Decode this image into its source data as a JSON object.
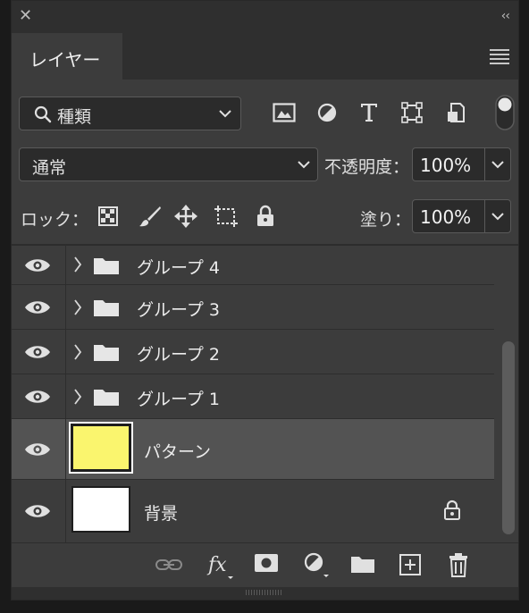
{
  "panel": {
    "tab_label": "レイヤー"
  },
  "filter": {
    "kind_label": "種類"
  },
  "blend": {
    "mode_label": "通常",
    "opacity_label": "不透明度：",
    "opacity_value": "100%"
  },
  "lock": {
    "label": "ロック：",
    "fill_label": "塗り：",
    "fill_value": "100%"
  },
  "layers": [
    {
      "name": "グループ 4",
      "type": "group"
    },
    {
      "name": "グループ 3",
      "type": "group"
    },
    {
      "name": "グループ 2",
      "type": "group"
    },
    {
      "name": "グループ 1",
      "type": "group"
    },
    {
      "name": "パターン",
      "type": "fill",
      "thumb_color": "#faf56e",
      "selected": true
    },
    {
      "name": "背景",
      "type": "background",
      "thumb_color": "#ffffff",
      "locked": true
    }
  ],
  "colors": {
    "panel_bg": "#3c3c3c",
    "selected_row": "#535353",
    "field_bg": "#2b2b2b"
  },
  "footer_icons": [
    "link-icon",
    "fx-icon",
    "mask-icon",
    "adjustment-icon",
    "folder-icon",
    "new-layer-icon",
    "trash-icon"
  ]
}
